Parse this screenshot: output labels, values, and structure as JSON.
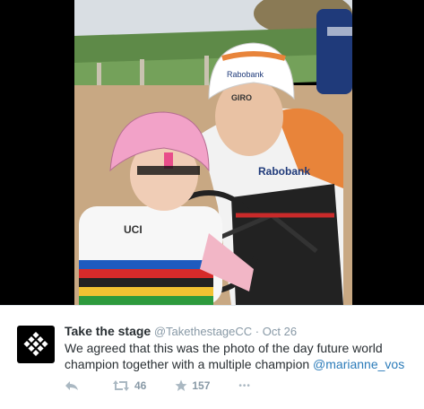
{
  "tweet": {
    "display_name": "Take the stage",
    "handle": "@TakethestageCC",
    "separator": "·",
    "date": "Oct 26",
    "text_before": "We agreed that this was the photo of the day future world champion together with a multiple champion ",
    "mention": "@marianne_vos",
    "retweet_count": "46",
    "favorite_count": "157",
    "more_label": "•••"
  },
  "photo": {
    "jersey_text_rabobank": "Rabobank",
    "helmet_brand": "GIRO",
    "child_jersey_text": "UCI"
  },
  "colors": {
    "link": "#2b7bb9",
    "muted": "#8899a6",
    "text": "#292f33"
  }
}
